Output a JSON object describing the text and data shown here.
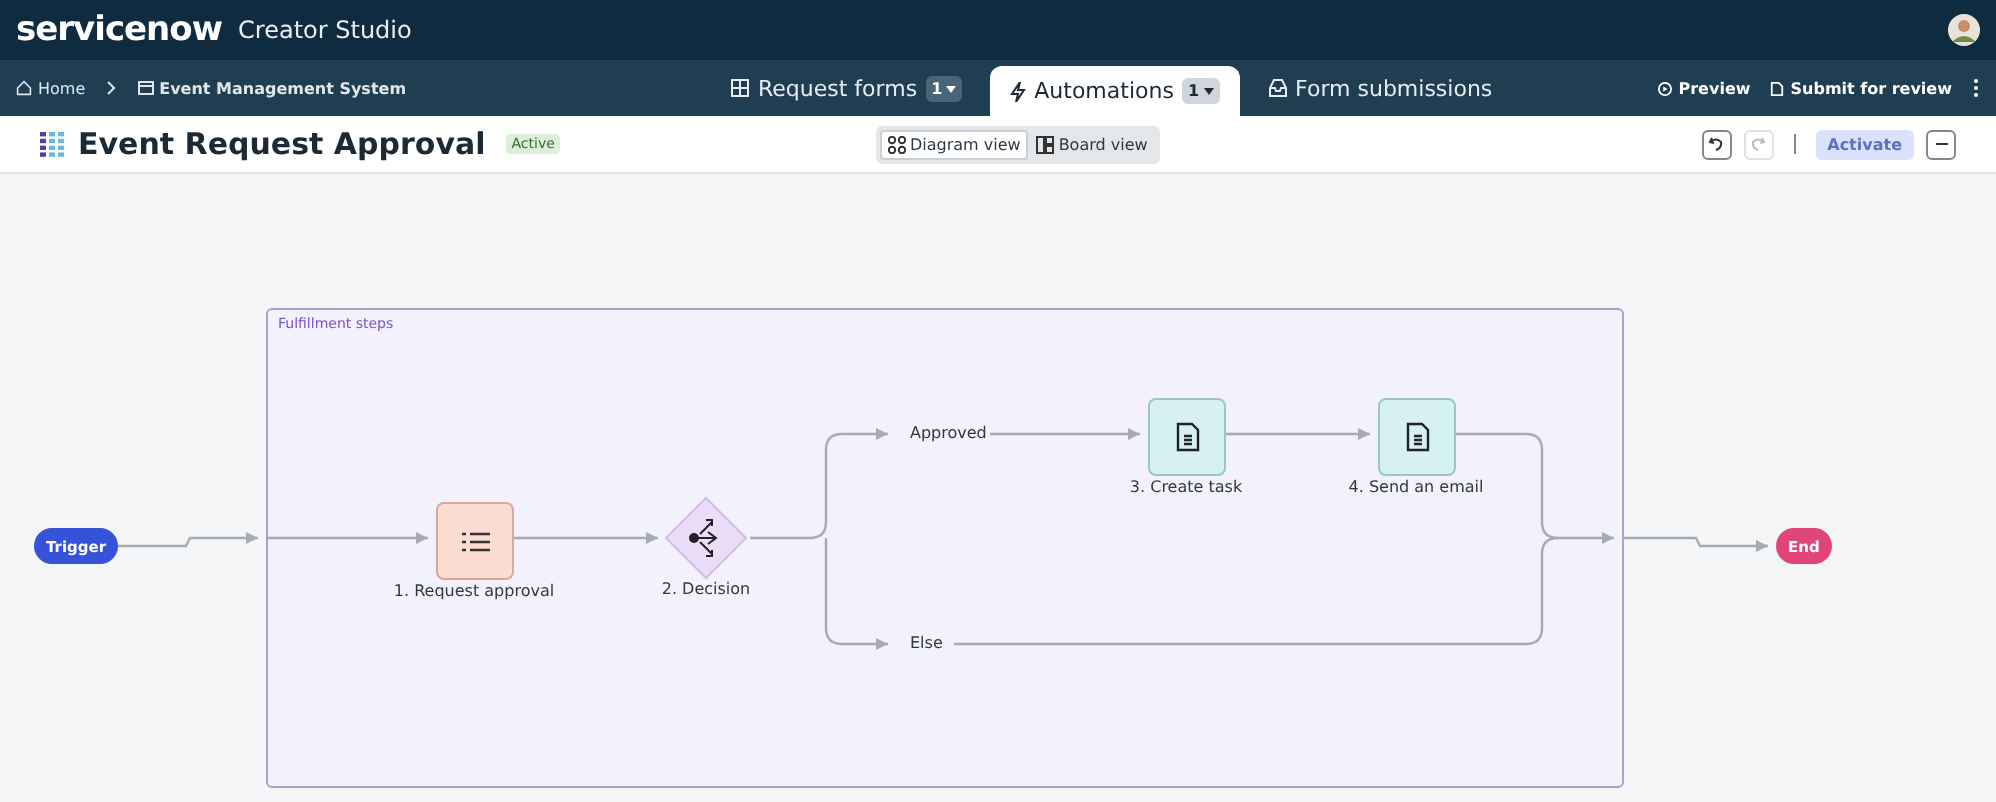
{
  "header": {
    "brand": "servicenow",
    "product": "Creator Studio"
  },
  "breadcrumb": [
    {
      "label": "Home",
      "kind": "home"
    },
    {
      "label": "Event Management System",
      "kind": "app"
    }
  ],
  "tabs": [
    {
      "label": "Request forms",
      "badge": "1",
      "selected": false,
      "kind": "forms"
    },
    {
      "label": "Automations",
      "badge": "1",
      "selected": true,
      "kind": "flow"
    },
    {
      "label": "Form submissions",
      "selected": false,
      "kind": "inbox"
    }
  ],
  "nav_actions": [
    {
      "label": "Preview",
      "kind": "preview"
    },
    {
      "label": "Submit for review",
      "kind": "submit"
    }
  ],
  "title": "Event Request Approval",
  "status": "Active",
  "views": [
    {
      "label": "Diagram view",
      "selected": true,
      "kind": "diagram"
    },
    {
      "label": "Board view",
      "selected": false,
      "kind": "board"
    }
  ],
  "activate": {
    "label": "Activate",
    "disabled": true
  },
  "diagram": {
    "group_label": "Fulfillment steps",
    "nodes": [
      {
        "kind": "trigger",
        "label": "Trigger"
      },
      {
        "kind": "approval",
        "label": "1. Request approval"
      },
      {
        "kind": "decision",
        "label": "2. Decision"
      },
      {
        "kind": "task",
        "label": "3. Create task"
      },
      {
        "kind": "task",
        "label": "4. Send an email"
      },
      {
        "kind": "end",
        "label": "End"
      }
    ],
    "branches": [
      "Approved",
      "Else"
    ]
  }
}
